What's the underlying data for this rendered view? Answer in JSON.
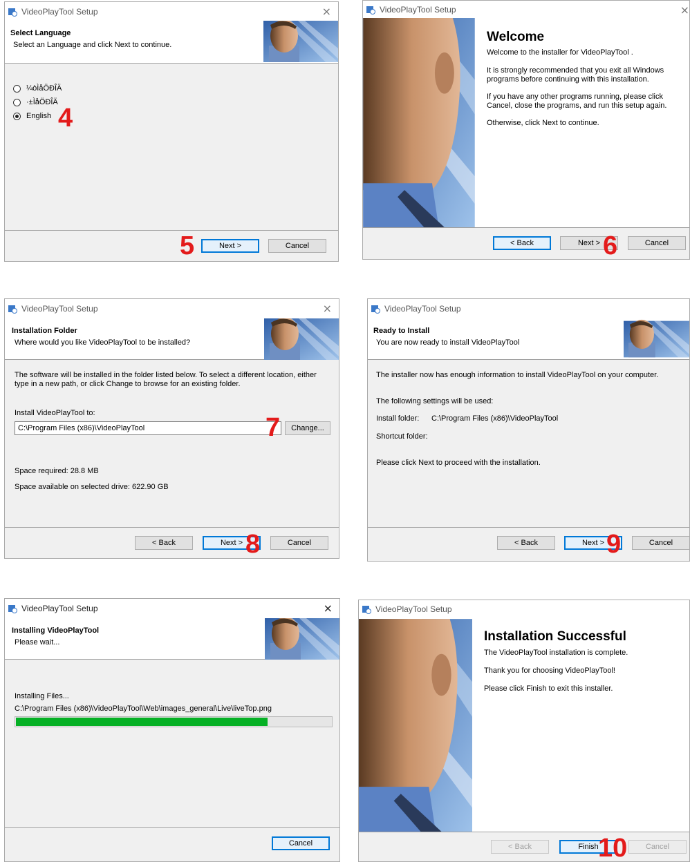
{
  "app_title": "VideoPlayTool Setup",
  "close_glyph": "×",
  "step_markers": [
    "4",
    "5",
    "6",
    "7",
    "8",
    "9",
    "10"
  ],
  "w1": {
    "header_title": "Select Language",
    "header_sub": "Select an Language and click Next to continue.",
    "options": [
      {
        "label": "¼òÌåÖÐÎÄ",
        "checked": false
      },
      {
        "label": "·±ÌåÖÐÎÄ",
        "checked": false
      },
      {
        "label": "English",
        "checked": true
      }
    ],
    "next": "Next >",
    "cancel": "Cancel"
  },
  "w2": {
    "title": "Welcome",
    "p1": "Welcome to the installer for VideoPlayTool .",
    "p2": "It is strongly recommended that you exit all Windows programs before continuing with this installation.",
    "p3": "If you have any other programs running, please click Cancel, close the programs, and run this setup again.",
    "p4": "Otherwise, click Next to continue.",
    "back": "< Back",
    "next": "Next >",
    "cancel": "Cancel"
  },
  "w3": {
    "header_title": "Installation Folder",
    "header_sub": "Where would you like VideoPlayTool to be installed?",
    "intro": "The software will be installed in the folder listed below. To select a different location, either type in a new path, or click Change to browse for an existing folder.",
    "install_label": "Install VideoPlayTool to:",
    "path": "C:\\Program Files (x86)\\VideoPlayTool",
    "change": "Change...",
    "space_required": "Space required: 28.8 MB",
    "space_available": "Space available on selected drive: 622.90 GB",
    "back": "< Back",
    "next": "Next >",
    "cancel": "Cancel"
  },
  "w4": {
    "header_title": "Ready to Install",
    "header_sub": "You are now ready to install VideoPlayTool",
    "l1": "The installer now has enough information to install VideoPlayTool on your computer.",
    "l2": "The following settings will be used:",
    "folder_label": "Install folder:",
    "folder_value": "C:\\Program Files (x86)\\VideoPlayTool",
    "shortcut_label": "Shortcut folder:",
    "l3": "Please click Next to proceed with the installation.",
    "back": "< Back",
    "next": "Next >",
    "cancel": "Cancel"
  },
  "w5": {
    "header_title": "Installing VideoPlayTool",
    "header_sub": "Please wait...",
    "status": "Installing Files...",
    "file": "C:\\Program Files (x86)\\VideoPlayTool\\Web\\images_general\\Live\\liveTop.png",
    "progress": 0.8,
    "cancel": "Cancel"
  },
  "w6": {
    "title": "Installation Successful",
    "p1": "The VideoPlayTool  installation is complete.",
    "p2": "Thank you for choosing VideoPlayTool!",
    "p3": "Please click Finish to exit this installer.",
    "back": "< Back",
    "finish": "Finish",
    "cancel": "Cancel"
  },
  "colors": {
    "accent": "#0078d7",
    "step_marker": "#e31b1b",
    "progress": "#06b025"
  }
}
